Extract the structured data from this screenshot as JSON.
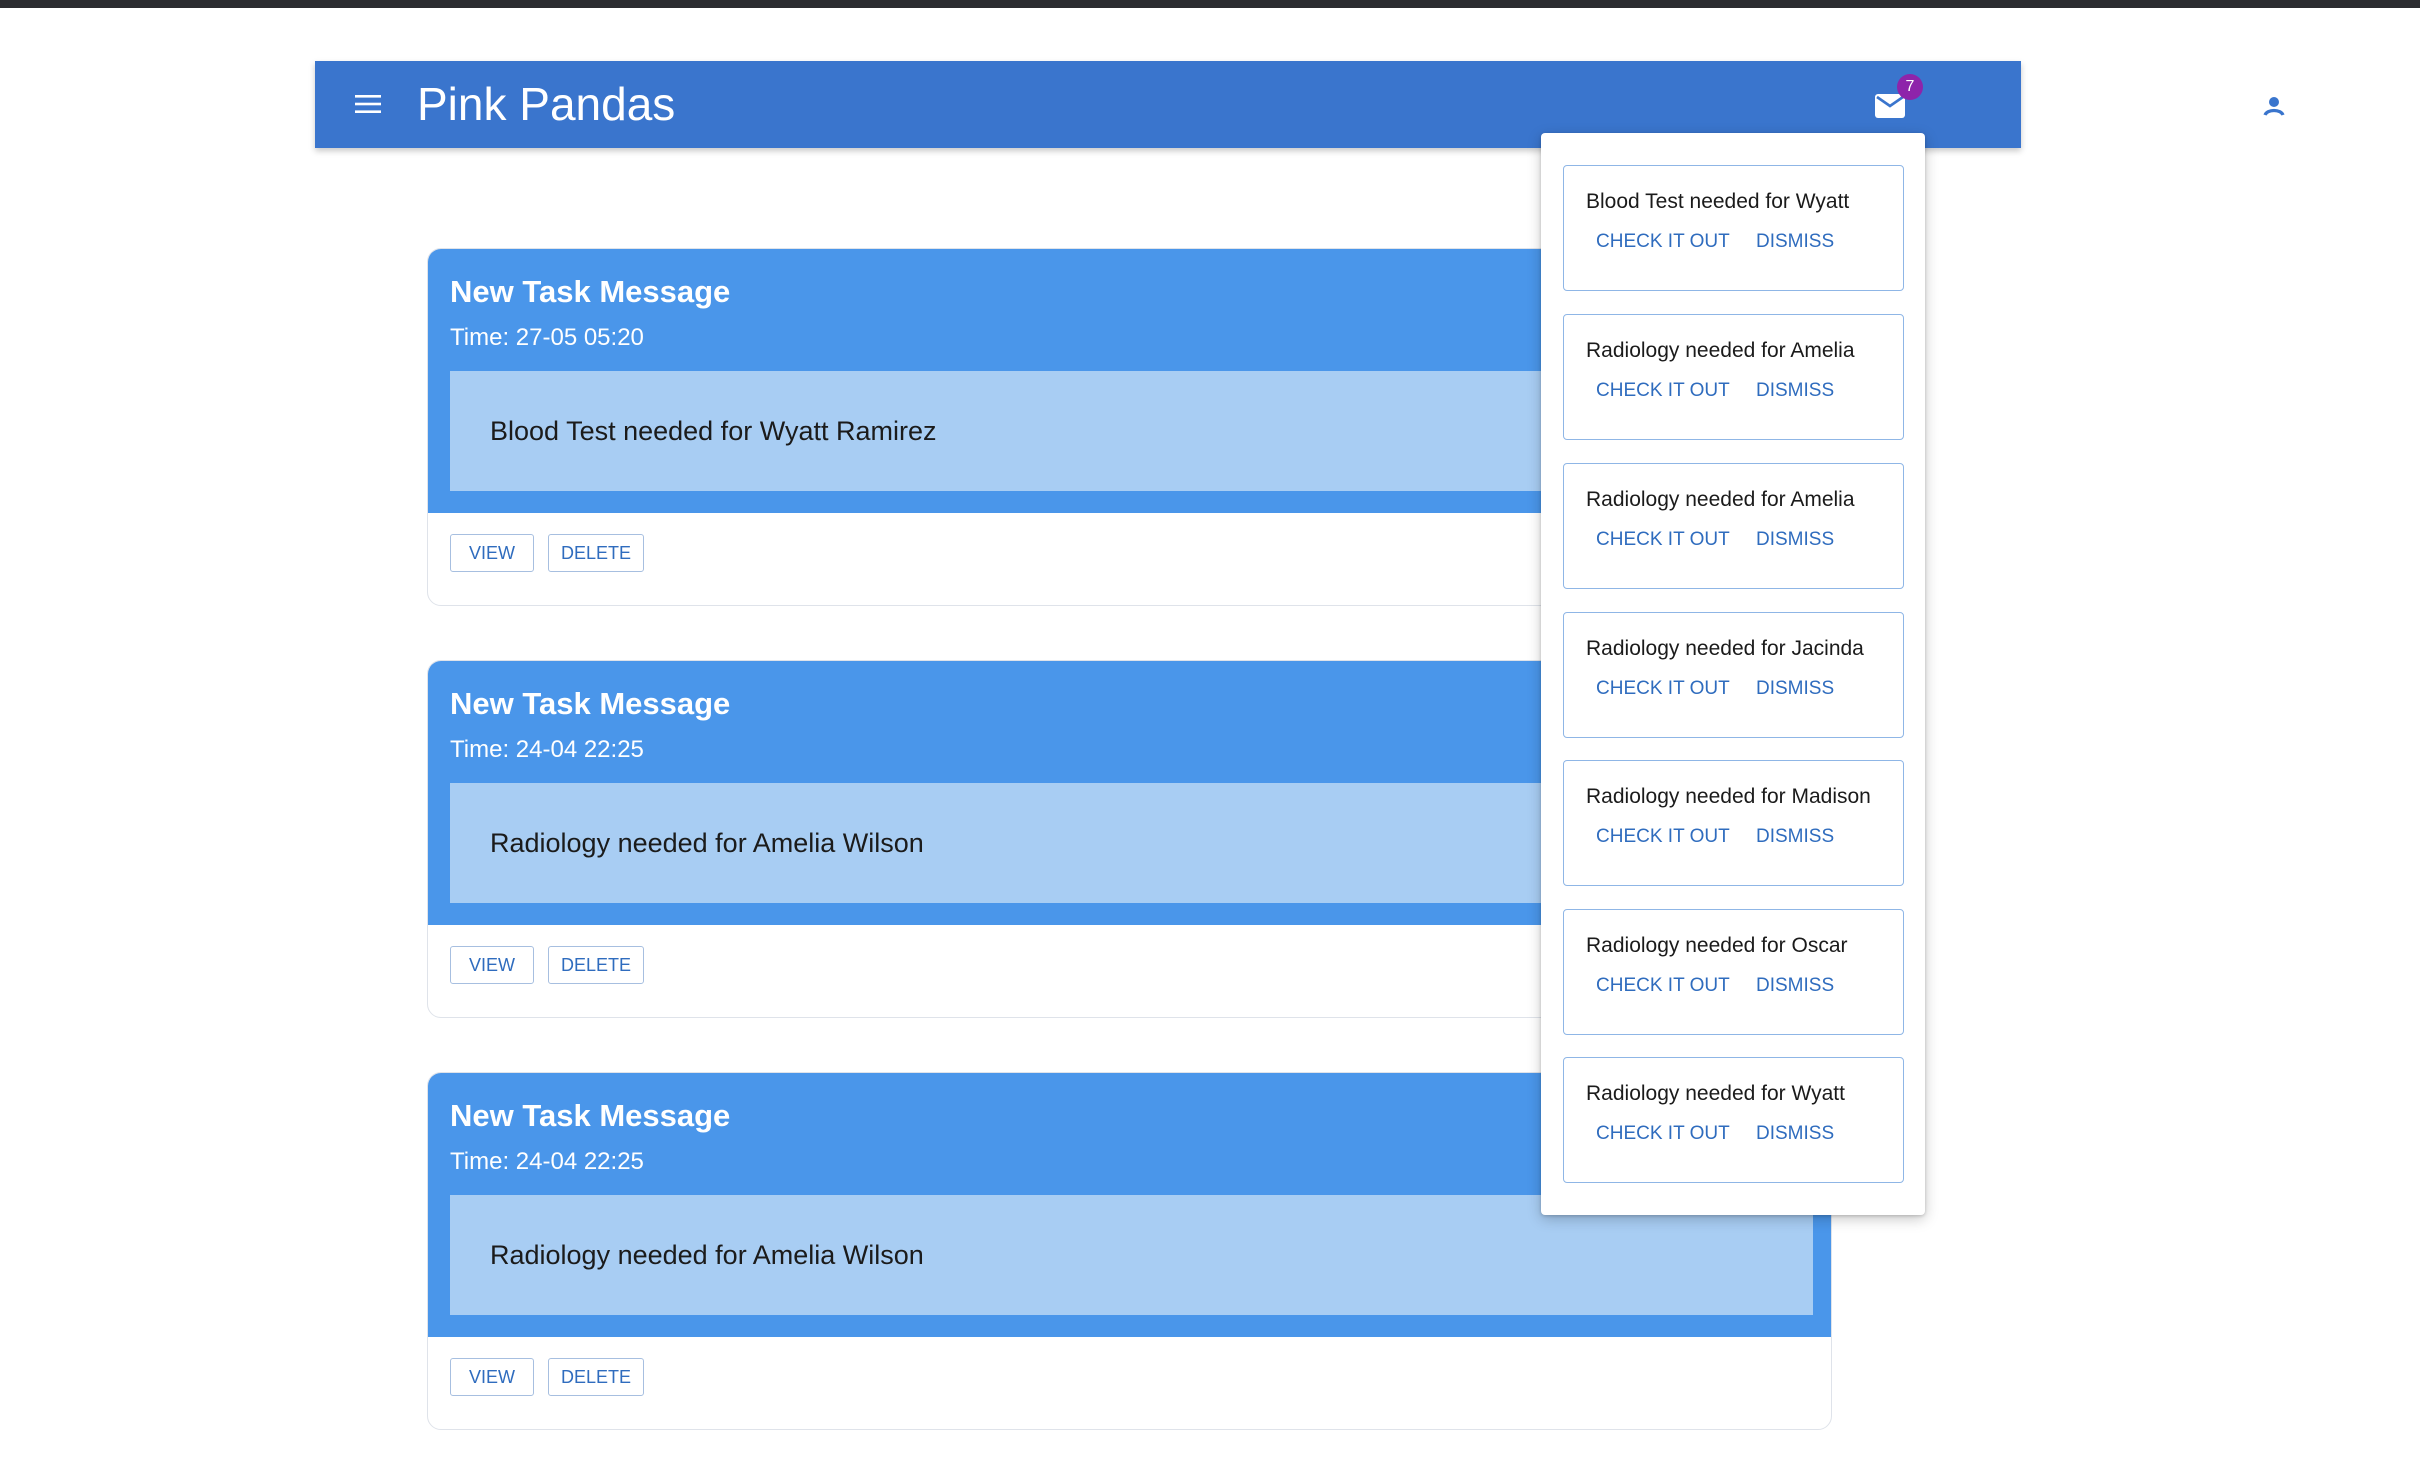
{
  "app": {
    "title": "Pink Pandas",
    "menu_icon": "hamburger-menu-icon",
    "mail_icon": "envelope-icon",
    "mail_badge_count": "7",
    "account_icon": "account-circle-icon",
    "colors": {
      "appbar": "#3a75cd",
      "card_header": "#4a96ea",
      "card_message": "#a8cdf3",
      "badge": "#8e24aa",
      "link": "#2f6cbe"
    }
  },
  "messages": [
    {
      "title": "New Task Message",
      "time": "Time: 27-05 05:20",
      "body": "Blood Test needed for Wyatt Ramirez",
      "view_label": "VIEW",
      "delete_label": "DELETE"
    },
    {
      "title": "New Task Message",
      "time": "Time: 24-04 22:25",
      "body": "Radiology needed for Amelia Wilson",
      "view_label": "VIEW",
      "delete_label": "DELETE"
    },
    {
      "title": "New Task Message",
      "time": "Time: 24-04 22:25",
      "body": "Radiology needed for Amelia Wilson",
      "view_label": "VIEW",
      "delete_label": "DELETE"
    }
  ],
  "notifications": [
    {
      "text": "Blood Test needed for Wyatt",
      "check_label": "CHECK IT OUT",
      "dismiss_label": "DISMISS"
    },
    {
      "text": "Radiology needed for Amelia",
      "check_label": "CHECK IT OUT",
      "dismiss_label": "DISMISS"
    },
    {
      "text": "Radiology needed for Amelia",
      "check_label": "CHECK IT OUT",
      "dismiss_label": "DISMISS"
    },
    {
      "text": "Radiology needed for Jacinda",
      "check_label": "CHECK IT OUT",
      "dismiss_label": "DISMISS"
    },
    {
      "text": "Radiology needed for Madison",
      "check_label": "CHECK IT OUT",
      "dismiss_label": "DISMISS"
    },
    {
      "text": "Radiology needed for Oscar",
      "check_label": "CHECK IT OUT",
      "dismiss_label": "DISMISS"
    },
    {
      "text": "Radiology needed for Wyatt",
      "check_label": "CHECK IT OUT",
      "dismiss_label": "DISMISS"
    }
  ]
}
